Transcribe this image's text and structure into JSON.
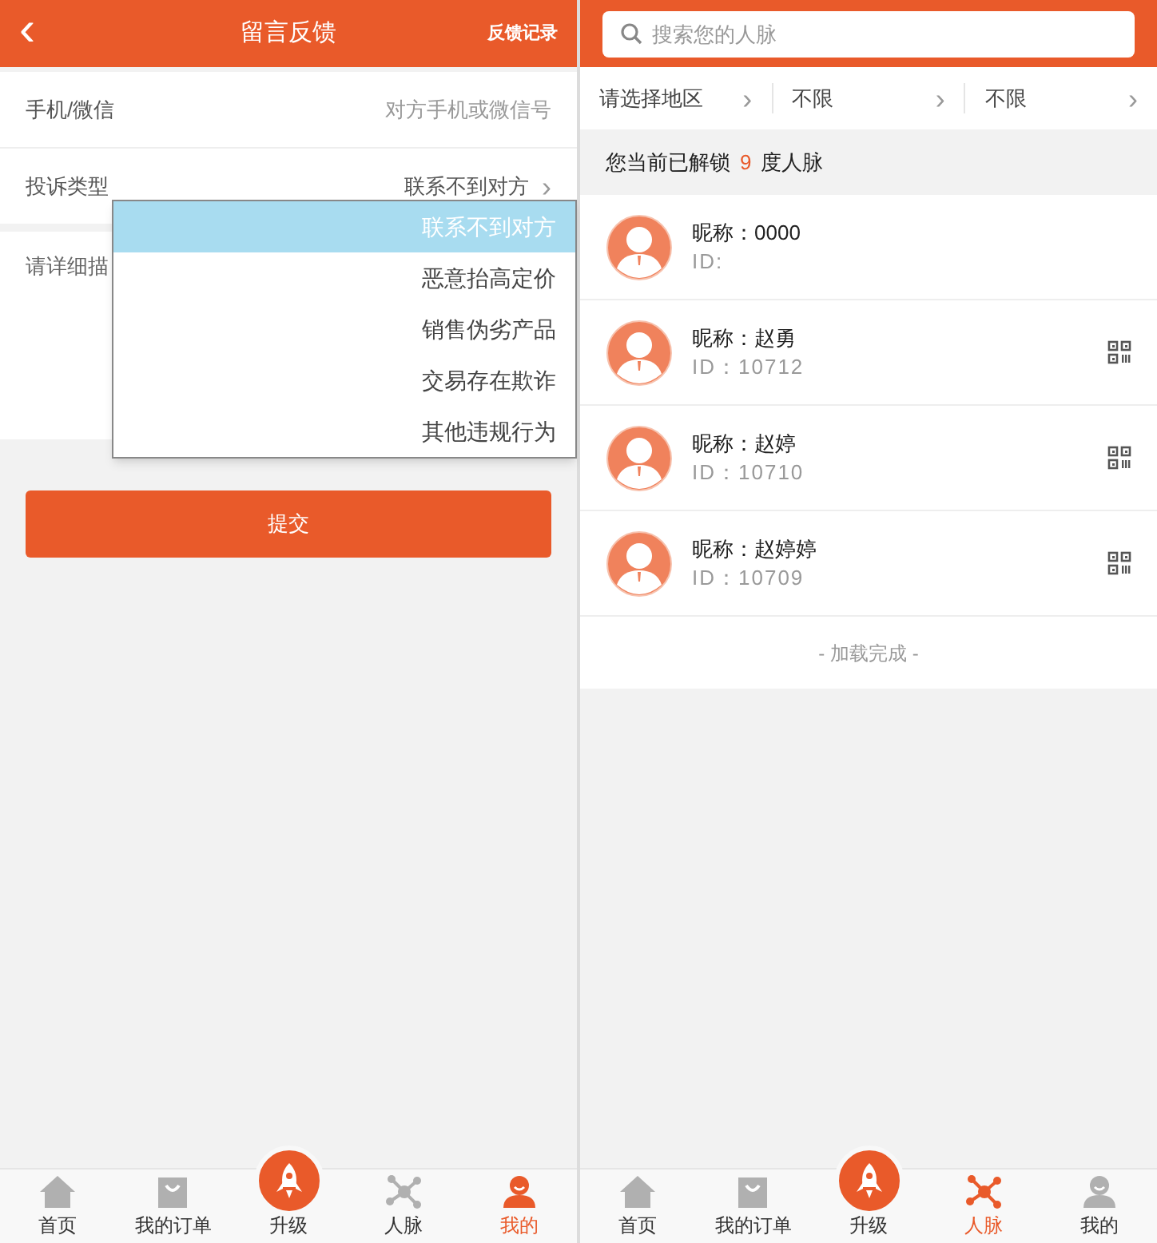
{
  "feedback_screen": {
    "header": {
      "back": "‹",
      "title": "留言反馈",
      "action": "反馈记录"
    },
    "contact_field": {
      "label": "手机/微信",
      "placeholder": "对方手机或微信号"
    },
    "complaint_type": {
      "label": "投诉类型",
      "value": "联系不到对方",
      "arrow": "›"
    },
    "description": {
      "placeholder": "请详细描"
    },
    "dropdown": [
      {
        "label": "联系不到对方",
        "selected": true
      },
      {
        "label": "恶意抬高定价",
        "selected": false
      },
      {
        "label": "销售伪劣产品",
        "selected": false
      },
      {
        "label": "交易存在欺诈",
        "selected": false
      },
      {
        "label": "其他违规行为",
        "selected": false
      }
    ],
    "submit": "提交",
    "tab_bar": [
      {
        "label": "首页",
        "kind": "home",
        "selected": false
      },
      {
        "label": "我的订单",
        "kind": "bag",
        "selected": false
      },
      {
        "label": "升级",
        "kind": "rocket",
        "selected": false
      },
      {
        "label": "人脉",
        "kind": "network",
        "selected": false
      },
      {
        "label": "我的",
        "kind": "person",
        "selected": true
      }
    ]
  },
  "contacts_screen": {
    "search": {
      "placeholder": "搜索您的人脉"
    },
    "filters": [
      {
        "label": "请选择地区",
        "arrow": "›"
      },
      {
        "label": "不限",
        "arrow": "›"
      },
      {
        "label": "不限",
        "arrow": "›"
      }
    ],
    "unlock_notice": {
      "before": "您当前已解锁",
      "count": "9",
      "after": "度人脉"
    },
    "contacts": [
      {
        "nickname": "昵称：0000",
        "id": "ID:",
        "qr_code": false
      },
      {
        "nickname": "昵称：赵勇",
        "id": "ID：10712",
        "qr_code": true
      },
      {
        "nickname": "昵称：赵婷",
        "id": "ID：10710",
        "qr_code": true
      },
      {
        "nickname": "昵称：赵婷婷",
        "id": "ID：10709",
        "qr_code": true
      }
    ],
    "footer": "- 加载完成 -",
    "tab_bar": [
      {
        "label": "首页",
        "kind": "home",
        "selected": false
      },
      {
        "label": "我的订单",
        "kind": "bag",
        "selected": false
      },
      {
        "label": "升级",
        "kind": "rocket",
        "selected": false
      },
      {
        "label": "人脉",
        "kind": "network",
        "selected": true
      },
      {
        "label": "我的",
        "kind": "person",
        "selected": false
      }
    ]
  }
}
